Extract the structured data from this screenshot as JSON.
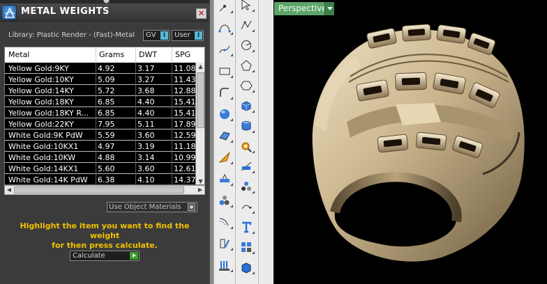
{
  "panel": {
    "title": "METAL WEIGHTS",
    "close_label": "✕",
    "library": "Library: Plastic Render - (Fast)-Metal",
    "gv_label": "GV",
    "gv_toggle": "I",
    "user_label": "User",
    "user_toggle": "I",
    "columns": [
      "Metal",
      "Grams",
      "DWT",
      "SPG"
    ],
    "rows": [
      [
        "Yellow Gold:9KY",
        "4.92",
        "3.17",
        "11.08"
      ],
      [
        "Yellow Gold:10KY",
        "5.09",
        "3.27",
        "11.43"
      ],
      [
        "Yellow Gold:14KY",
        "5.72",
        "3.68",
        "12.88"
      ],
      [
        "Yellow Gold:18KY",
        "6.85",
        "4.40",
        "15.41"
      ],
      [
        "Yellow Gold:18KY R...",
        "6.85",
        "4.40",
        "15.41"
      ],
      [
        "Yellow Gold:22KY",
        "7.95",
        "5.11",
        "17.89"
      ],
      [
        "White Gold:9K PdW",
        "5.59",
        "3.60",
        "12.59"
      ],
      [
        "White Gold:10KX1",
        "4.97",
        "3.19",
        "11.18"
      ],
      [
        "White Gold:10KW",
        "4.88",
        "3.14",
        "10.99"
      ],
      [
        "White Gold:14KX1",
        "5.60",
        "3.60",
        "12.61"
      ],
      [
        "White Gold:14K PdW",
        "6.38",
        "4.10",
        "14.37"
      ]
    ],
    "use_object_materials": "Use Object Materials",
    "instruction_line1": "Highlight the item you want to find the weight",
    "instruction_line2": "for then press calculate.",
    "calculate_label": "Calculate"
  },
  "viewport": {
    "label": "Perspective"
  },
  "colors": {
    "panel_bg": "#3b3b3b",
    "instruction": "#f2c100",
    "viewport_label": "#5fa46a",
    "toolbar_bg": "#ececec"
  },
  "toolbar_icons": {
    "column1": [
      "curve-point-icon",
      "curve-bezier-icon",
      "curve-interpolate-icon",
      "rectangle-icon",
      "fillet-curve-icon",
      "sphere-icon",
      "surface-patch-icon",
      "gumball-arrow-icon",
      "boolean-icon",
      "group-spheres-icon",
      "offset-curve-icon",
      "layout-icon",
      "array-icon"
    ],
    "column2": [
      "select-arrow-icon",
      "polyline-icon",
      "circle-icon",
      "polygon-icon",
      "hexagon-icon",
      "box-icon",
      "cylinder-icon",
      "gear-settings-icon",
      "split-icon",
      "object-group-icon",
      "rotate-arc-icon",
      "text-tool-icon",
      "grid-array-icon",
      "box-solid-icon"
    ]
  }
}
